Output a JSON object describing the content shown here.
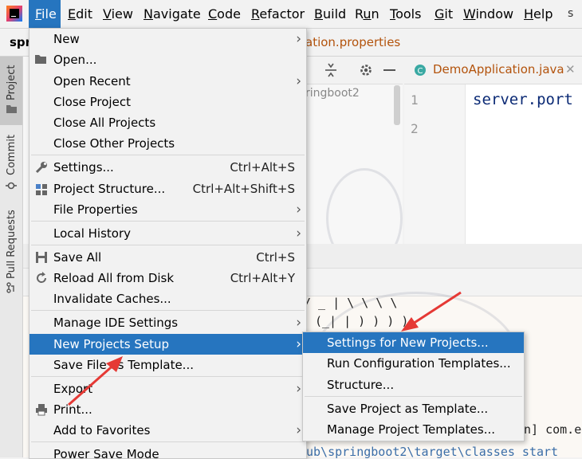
{
  "menubar": {
    "items": [
      {
        "label": "File",
        "hot": "F",
        "rest": "ile"
      },
      {
        "label": "Edit",
        "hot": "E",
        "rest": "dit"
      },
      {
        "label": "View",
        "hot": "V",
        "rest": "iew"
      },
      {
        "label": "Navigate",
        "hot": "N",
        "rest": "avigate"
      },
      {
        "label": "Code",
        "hot": "C",
        "rest": "ode"
      },
      {
        "label": "Refactor",
        "hot": "R",
        "rest": "efactor"
      },
      {
        "label": "Build",
        "hot": "B",
        "rest": "uild"
      },
      {
        "label": "Run",
        "pre": "R",
        "hot": "u",
        "rest": "n"
      },
      {
        "label": "Tools",
        "hot": "T",
        "rest": "ools"
      },
      {
        "label": "Git",
        "hot": "G",
        "rest": "it"
      },
      {
        "label": "Window",
        "hot": "W",
        "rest": "indow"
      },
      {
        "label": "Help",
        "hot": "H",
        "rest": "elp"
      }
    ],
    "overflow_text": "s"
  },
  "project_name_peek": "spr",
  "behind_tab_text": "ation.properties",
  "project_tree_peek": "ringboot2",
  "editor": {
    "tab_title": "DemoApplication.java",
    "line_numbers": [
      "1",
      "2"
    ],
    "code_line": "server.port"
  },
  "side_tabs": [
    "Project",
    "Commit",
    "Pull Requests"
  ],
  "console": {
    "ascii1": "/ _ | \\ \\ \\ \\",
    "ascii2": "(_| |  ) ) ) )",
    "log_text": "n] com.e",
    "path_text": "ub\\springboot2\\target\\classes start"
  },
  "file_menu": {
    "new": "New",
    "open": "Open...",
    "open_recent": "Open Recent",
    "close_project": "Close Project",
    "close_all_projects": "Close All Projects",
    "close_other_projects": "Close Other Projects",
    "settings": "Settings...",
    "settings_shortcut": "Ctrl+Alt+S",
    "project_structure": "Project Structure...",
    "project_structure_shortcut": "Ctrl+Alt+Shift+S",
    "file_properties": "File Properties",
    "local_history": "Local History",
    "save_all": "Save All",
    "save_all_shortcut": "Ctrl+S",
    "reload_all": "Reload All from Disk",
    "reload_all_shortcut": "Ctrl+Alt+Y",
    "invalidate_caches": "Invalidate Caches...",
    "manage_ide_settings": "Manage IDE Settings",
    "new_projects_setup": "New Projects Setup",
    "save_file_as_template": "Save File as Template...",
    "export": "Export",
    "print": "Print...",
    "add_to_favorites": "Add to Favorites",
    "power_save_mode": "Power Save Mode"
  },
  "submenu": {
    "settings_for_new_projects": "Settings for New Projects...",
    "run_configuration_templates": "Run Configuration Templates...",
    "structure": "Structure...",
    "save_project_as_template": "Save Project as Template...",
    "manage_project_templates": "Manage Project Templates..."
  },
  "colors": {
    "selection": "#2675bf",
    "annotation_arrow": "#e53935",
    "menu_bg": "#f2f2f2"
  }
}
